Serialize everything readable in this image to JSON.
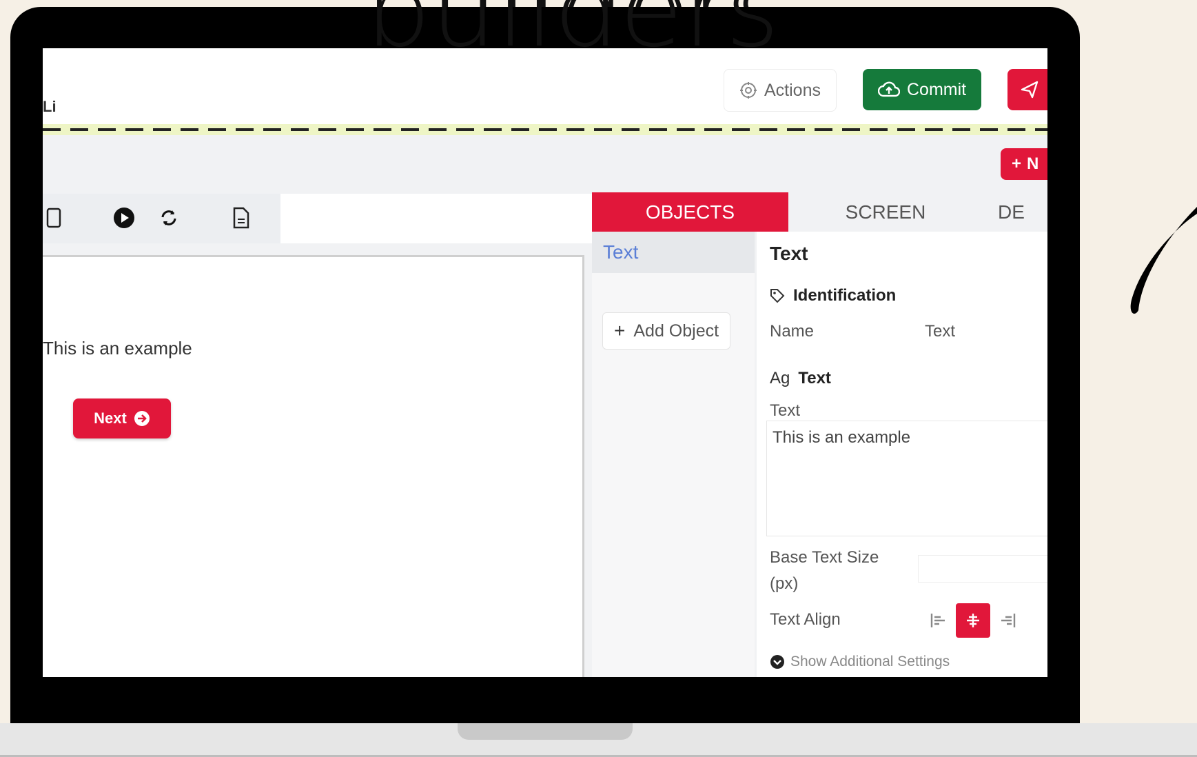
{
  "background": {
    "heading": "builders"
  },
  "app": {
    "title": "Li"
  },
  "header": {
    "actions_label": "Actions",
    "commit_label": "Commit"
  },
  "new_button": {
    "label": "N"
  },
  "tabs": {
    "objects": "OBJECTS",
    "screen": "SCREEN",
    "third": "DE"
  },
  "objects": {
    "items": [
      "Text"
    ],
    "add_label": "Add Object"
  },
  "canvas": {
    "text": "This is an example",
    "next_label": "Next"
  },
  "properties": {
    "title": "Text",
    "identification": {
      "heading": "Identification",
      "name_label": "Name",
      "name_value": "Text"
    },
    "text_section": {
      "icon_text": "Ag",
      "heading": "Text",
      "text_label": "Text",
      "text_value": "This is an example"
    },
    "base_size_label": "Base Text Size (px)",
    "text_align_label": "Text Align",
    "text_align_value": "center",
    "show_more": "Show Additional Settings"
  },
  "colors": {
    "accent": "#e1173a",
    "commit": "#157a3b"
  }
}
